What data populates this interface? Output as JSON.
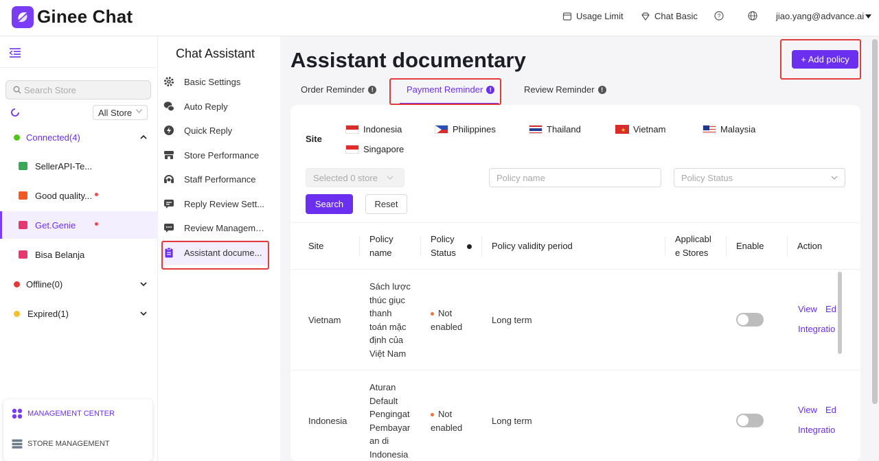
{
  "app": {
    "title": "Ginee Chat",
    "accent": "#6b2ff0"
  },
  "header": {
    "usage_limit": "Usage Limit",
    "plan": "Chat Basic",
    "user_email": "jiao.yang@advance.ai"
  },
  "sidebar": {
    "search_placeholder": "Search Store",
    "store_filter": "All Store",
    "connected_label": "Connected(4)",
    "stores": [
      "SellerAPI-Te...",
      "Good quality...",
      "Get.Genie",
      "Bisa Belanja"
    ],
    "offline_label": "Offline(0)",
    "expired_label": "Expired(1)",
    "management_center": "MANAGEMENT CENTER",
    "store_management": "STORE MANAGEMENT"
  },
  "menu": {
    "title": "Chat Assistant",
    "items": [
      "Basic Settings",
      "Auto Reply",
      "Quick Reply",
      "Store Performance",
      "Staff Performance",
      "Reply Review Sett...",
      "Review Management",
      "Assistant docume..."
    ]
  },
  "main": {
    "title": "Assistant documentary",
    "add_button": "+ Add policy",
    "tabs": [
      "Order Reminder",
      "Payment Reminder",
      "Review Reminder"
    ],
    "site_label": "Site",
    "sites": [
      "Indonesia",
      "Philippines",
      "Thailand",
      "Vietnam",
      "Malaysia",
      "Singapore"
    ],
    "store_select_placeholder": "Selected 0 store",
    "policy_name_placeholder": "Policy name",
    "policy_status_placeholder": "Policy Status",
    "search_button": "Search",
    "reset_button": "Reset",
    "table": {
      "headers": {
        "site": "Site",
        "policy_name_1": "Policy",
        "policy_name_2": "name",
        "policy_status_1": "Policy",
        "policy_status_2": "Status",
        "validity": "Policy validity period",
        "stores_1": "Applicabl",
        "stores_2": "e Stores",
        "enable": "Enable",
        "action": "Action"
      },
      "rows": [
        {
          "site": "Vietnam",
          "name_lines": [
            "Sách lược",
            "thúc giục",
            "thanh",
            "toán mặc",
            "định của",
            "Việt Nam"
          ],
          "status_1": "Not",
          "status_2": "enabled",
          "validity": "Long term",
          "enabled": false,
          "view": "View",
          "edit": "Ed",
          "integration": "Integratio"
        },
        {
          "site": "Indonesia",
          "name_lines": [
            "Aturan",
            "Default",
            "Pengingat",
            "Pembayar",
            "an di",
            "Indonesia"
          ],
          "status_1": "Not",
          "status_2": "enabled",
          "validity": "Long term",
          "enabled": false,
          "view": "View",
          "edit": "Ed",
          "integration": "Integratio"
        }
      ]
    }
  }
}
